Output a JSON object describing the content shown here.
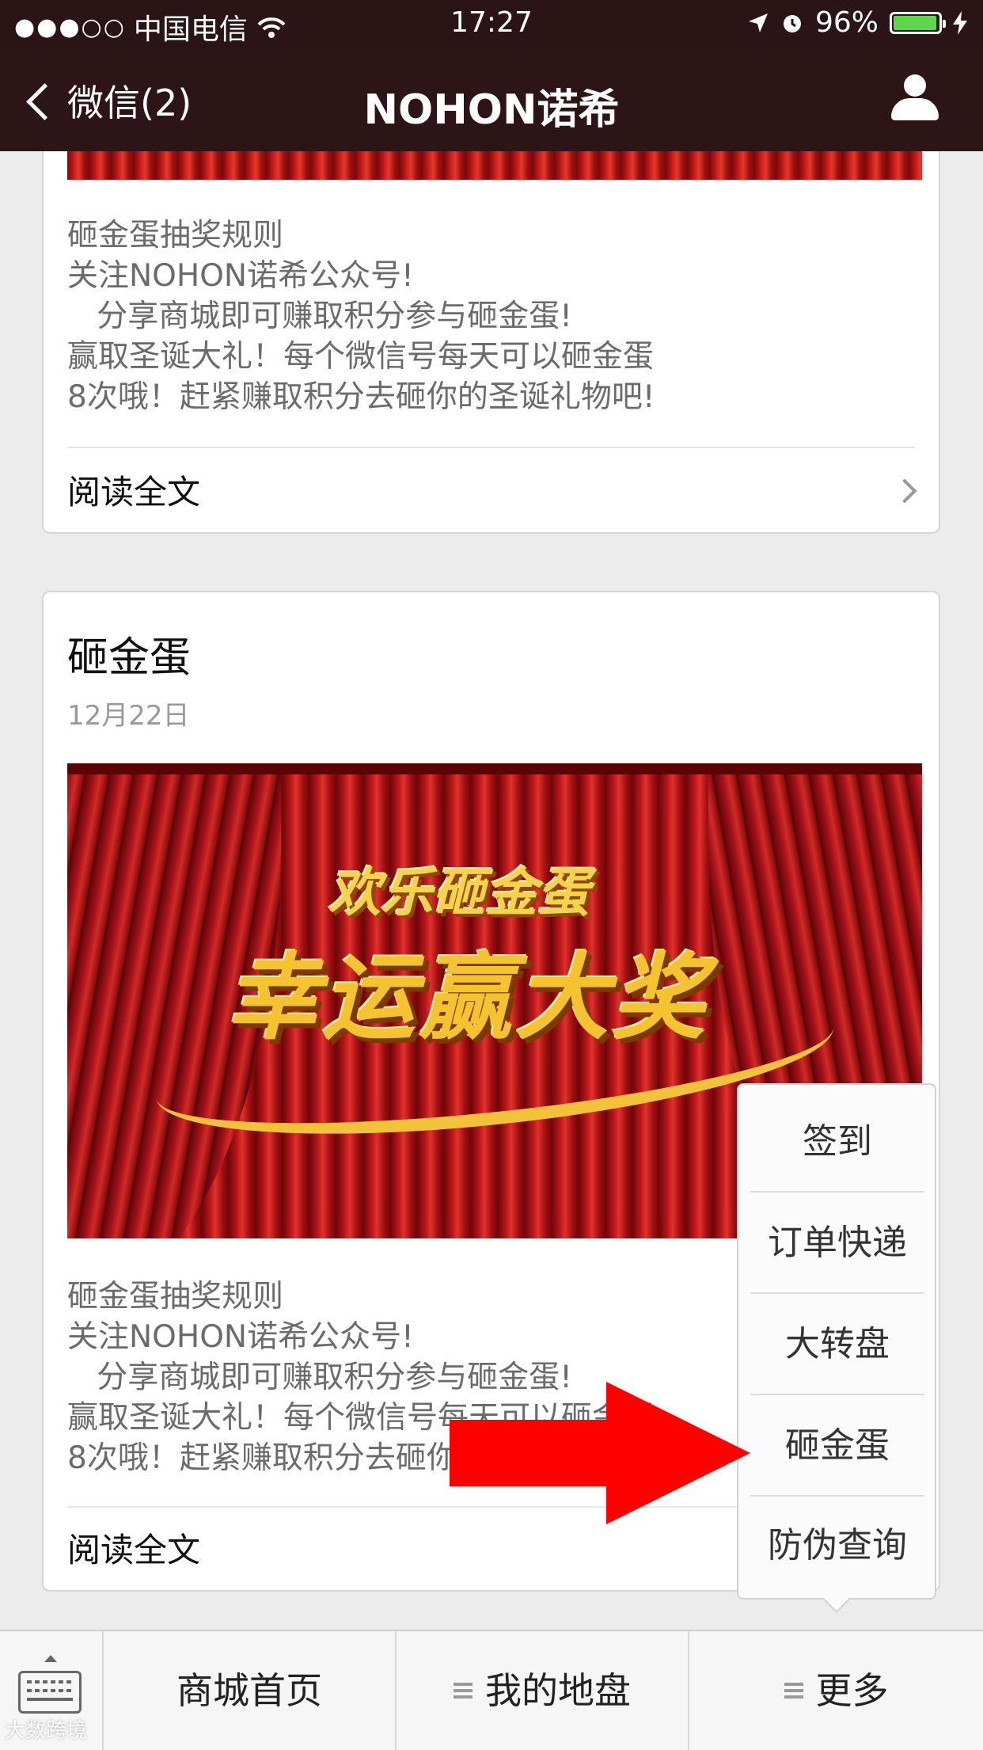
{
  "status_bar": {
    "signal": "●●●○○",
    "carrier": "中国电信",
    "time": "17:27",
    "battery_percent": "96%",
    "battery_level": 0.96,
    "battery_color": "#5cd64a"
  },
  "nav": {
    "back_label": "微信(2)",
    "title": "NOHON诺希"
  },
  "articles": [
    {
      "description": "砸金蛋抽奖规则\n关注NOHON诺希公众号!\n   分享商城即可赚取积分参与砸金蛋!\n赢取圣诞大礼！每个微信号每天可以砸金蛋\n8次哦！赶紧赚取积分去砸你的圣诞礼物吧!",
      "read_more": "阅读全文"
    },
    {
      "title": "砸金蛋",
      "date": "12月22日",
      "banner_line1": "欢乐砸金蛋",
      "banner_line2": "幸运赢大奖",
      "description": "砸金蛋抽奖规则\n关注NOHON诺希公众号!\n   分享商城即可赚取积分参与砸金蛋!\n赢取圣诞大礼！每个微信号每天可以砸金蛋\n8次哦！赶紧赚取积分去砸你的圣诞礼物吧!",
      "read_more": "阅读全文"
    }
  ],
  "popup_menu": {
    "items": [
      "签到",
      "订单快递",
      "大转盘",
      "砸金蛋",
      "防伪查询"
    ]
  },
  "bottom_menu": {
    "items": [
      "商城首页",
      "我的地盘",
      "更多"
    ]
  },
  "watermark": "大数跨境",
  "colors": {
    "nav_background": "#2d1517",
    "arrow": "#ff0000"
  }
}
